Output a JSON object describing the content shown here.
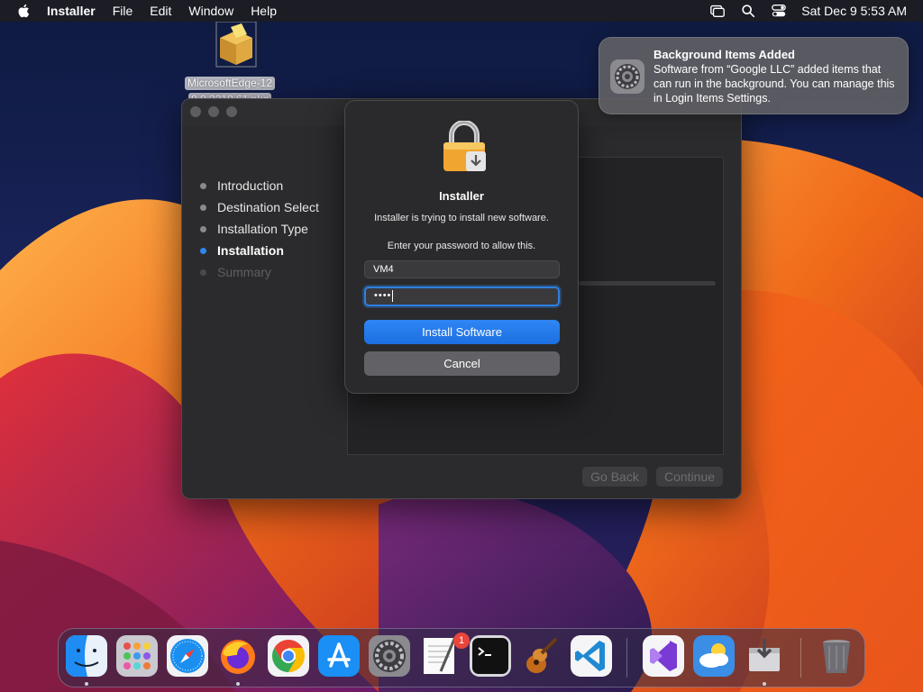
{
  "menubar": {
    "app_name": "Installer",
    "menus": [
      "File",
      "Edit",
      "Window",
      "Help"
    ],
    "clock": "Sat Dec 9  5:53 AM",
    "status_icons": [
      "screen-mirroring-icon",
      "search-icon",
      "control-center-icon"
    ]
  },
  "desktop": {
    "file_icon_label_line1": "MicrosoftEdge-12",
    "file_icon_label_line2": "0.0.2210.61.pkg"
  },
  "installer": {
    "steps": [
      {
        "label": "Introduction",
        "state": "done"
      },
      {
        "label": "Destination Select",
        "state": "done"
      },
      {
        "label": "Installation Type",
        "state": "done"
      },
      {
        "label": "Installation",
        "state": "active"
      },
      {
        "label": "Summary",
        "state": "disabled"
      }
    ],
    "go_back_label": "Go Back",
    "continue_label": "Continue"
  },
  "auth_dialog": {
    "title": "Installer",
    "message": "Installer is trying to install new software.",
    "prompt": "Enter your password to allow this.",
    "username_value": "VM4",
    "password_mask": "••••",
    "primary_button": "Install Software",
    "cancel_button": "Cancel"
  },
  "notification": {
    "title": "Background Items Added",
    "body": "Software from “Google LLC” added items that can run in the background. You can manage this in Login Items Settings."
  },
  "dock": {
    "apps": [
      "Finder",
      "Launchpad",
      "Safari",
      "Firefox",
      "Google Chrome",
      "App Store",
      "System Settings",
      "TextEdit",
      "Terminal",
      "GarageBand",
      "Visual Studio Code",
      "Visual Studio",
      "Weather",
      "Installer",
      "Trash"
    ],
    "system_settings_badge": "1"
  },
  "colors": {
    "accent": "#2e87f0",
    "badge": "#e8453c"
  }
}
